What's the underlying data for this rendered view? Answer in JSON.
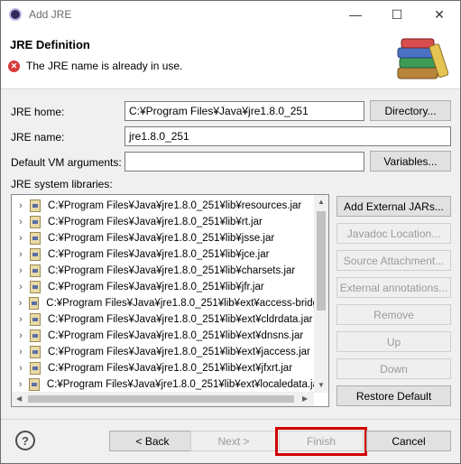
{
  "window": {
    "title": "Add JRE",
    "controls": {
      "minimize": "—",
      "maximize": "☐",
      "close": "✕"
    }
  },
  "banner": {
    "title": "JRE Definition",
    "message": "The JRE name is already in use.",
    "error_symbol": "✕"
  },
  "form": {
    "jre_home_label": "JRE home:",
    "jre_home_value": "C:¥Program Files¥Java¥jre1.8.0_251",
    "directory_button": "Directory...",
    "jre_name_label": "JRE name:",
    "jre_name_value": "jre1.8.0_251",
    "vm_args_label": "Default VM arguments:",
    "vm_args_value": "",
    "variables_button": "Variables...",
    "libraries_label": "JRE system libraries:"
  },
  "libraries": [
    "C:¥Program Files¥Java¥jre1.8.0_251¥lib¥resources.jar",
    "C:¥Program Files¥Java¥jre1.8.0_251¥lib¥rt.jar",
    "C:¥Program Files¥Java¥jre1.8.0_251¥lib¥jsse.jar",
    "C:¥Program Files¥Java¥jre1.8.0_251¥lib¥jce.jar",
    "C:¥Program Files¥Java¥jre1.8.0_251¥lib¥charsets.jar",
    "C:¥Program Files¥Java¥jre1.8.0_251¥lib¥jfr.jar",
    "C:¥Program Files¥Java¥jre1.8.0_251¥lib¥ext¥access-bridg",
    "C:¥Program Files¥Java¥jre1.8.0_251¥lib¥ext¥cldrdata.jar",
    "C:¥Program Files¥Java¥jre1.8.0_251¥lib¥ext¥dnsns.jar",
    "C:¥Program Files¥Java¥jre1.8.0_251¥lib¥ext¥jaccess.jar",
    "C:¥Program Files¥Java¥jre1.8.0_251¥lib¥ext¥jfxrt.jar",
    "C:¥Program Files¥Java¥jre1.8.0_251¥lib¥ext¥localedata.ja"
  ],
  "library_buttons": {
    "add_external": "Add External JARs...",
    "javadoc": "Javadoc Location...",
    "source": "Source Attachment...",
    "annotations": "External annotations...",
    "remove": "Remove",
    "up": "Up",
    "down": "Down",
    "restore": "Restore Default"
  },
  "footer": {
    "help": "?",
    "back": "< Back",
    "next": "Next >",
    "finish": "Finish",
    "cancel": "Cancel"
  },
  "colors": {
    "highlight": "#d10000",
    "error": "#d63a3a"
  }
}
